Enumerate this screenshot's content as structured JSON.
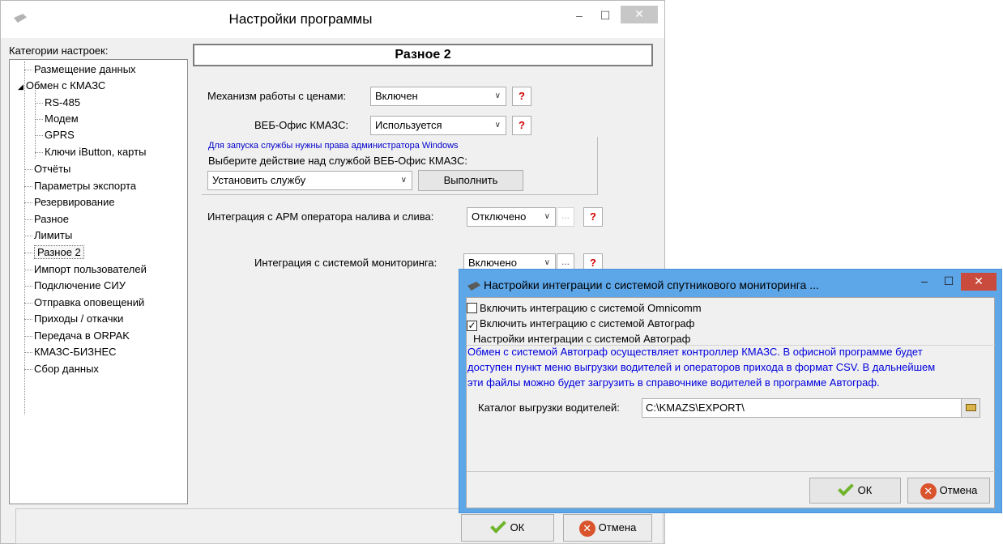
{
  "main_window": {
    "title": "Настройки программы",
    "minimize": "–",
    "maximize": "☐",
    "close": "✕"
  },
  "categories": {
    "header": "Категории настроек:",
    "items": [
      {
        "label": "Размещение данных"
      },
      {
        "label": "Обмен с КМАЗС",
        "expanded": true
      },
      {
        "label": "RS-485"
      },
      {
        "label": "Модем"
      },
      {
        "label": "GPRS"
      },
      {
        "label": "Ключи iButton, карты"
      },
      {
        "label": "Отчёты"
      },
      {
        "label": "Параметры экспорта"
      },
      {
        "label": "Резервирование"
      },
      {
        "label": "Разное"
      },
      {
        "label": "Лимиты"
      },
      {
        "label": "Разное 2",
        "selected": true
      },
      {
        "label": "Импорт пользователей"
      },
      {
        "label": "Подключение СИУ"
      },
      {
        "label": "Отправка оповещений"
      },
      {
        "label": "Приходы / откачки"
      },
      {
        "label": "Передача в ORPAK"
      },
      {
        "label": "КМАЗС-БИЗНЕС"
      },
      {
        "label": "Сбор данных"
      }
    ]
  },
  "settings": {
    "section_title": "Разное 2",
    "price_mechanism": {
      "label": "Механизм работы с ценами:",
      "value": "Включен"
    },
    "web_office": {
      "label": "ВЕБ-Офис КМАЗС:",
      "value": "Используется"
    },
    "admin_note": "Для запуска службы нужны права администратора Windows",
    "service_action_label": "Выберите действие над службой ВЕБ-Офис КМАЗС:",
    "service_action_value": "Установить службу",
    "execute_button": "Выполнить",
    "arm_integration": {
      "label": "Интеграция с АРМ оператора налива и слива:",
      "value": "Отключено"
    },
    "monitoring_integration": {
      "label": "Интеграция с системой мониторинга:",
      "value": "Включено"
    },
    "help": "?",
    "more": "..."
  },
  "main_buttons": {
    "ok": "ОК",
    "cancel": "Отмена"
  },
  "dialog": {
    "title": "Настройки интеграции с системой спутникового мониторинга ...",
    "minimize": "–",
    "maximize": "☐",
    "close": "✕",
    "omnicomm": {
      "label": "Включить интеграцию с системой Omnicomm",
      "checked": false
    },
    "autograph": {
      "label": "Включить интеграцию с системой Автограф",
      "checked": true
    },
    "group_title": "Настройки интеграции с системой Автограф",
    "info_lines": [
      "Обмен с системой Автограф осуществляет контроллер КМАЗС. В офисной программе будет",
      "доступен пункт меню выгрузки водителей и операторов прихода в формат CSV. В дальнейшем",
      "эти файлы можно будет загрузить в справочнике водителей в программе Автограф."
    ],
    "catalog_label": "Каталог выгрузки водителей:",
    "catalog_value": "C:\\KMAZS\\EXPORT\\",
    "ok": "ОК",
    "cancel": "Отмена"
  },
  "colors": {
    "accent": "#5da6e8",
    "link_text": "#0000dd",
    "help": "#d40000",
    "ok_icon": "#6fb52c",
    "cancel_icon": "#d9532c"
  }
}
